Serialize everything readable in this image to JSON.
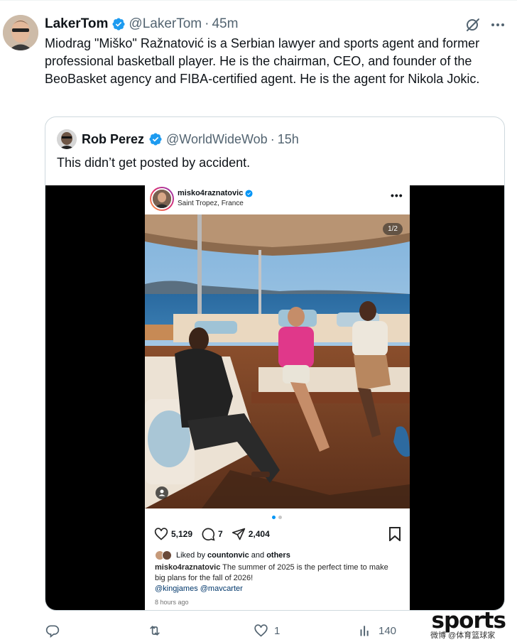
{
  "tweet": {
    "author_name": "LakerTom",
    "author_handle": "@LakerTom",
    "separator": "·",
    "time": "45m",
    "text": "Miodrag \"Miško\" Ražnatović is a Serbian lawyer and sports agent and former professional basketball player. He is the chairman, CEO, and founder of the BeoBasket agency and FIBA-certified agent. He is the agent for Nikola Jokic."
  },
  "quote": {
    "author_name": "Rob Perez",
    "author_handle": "@WorldWideWob",
    "separator": "·",
    "time": "15h",
    "text": "This didn’t get posted by accident."
  },
  "instagram": {
    "username": "misko4raznatovic",
    "location": "Saint Tropez, France",
    "more": "•••",
    "counter": "1/2",
    "likes": "5,129",
    "comments": "7",
    "shares": "2,404",
    "liked_prefix": "Liked by ",
    "liked_user": "countonvic",
    "liked_and": " and ",
    "liked_others": "others",
    "caption_user": "misko4raznatovic",
    "caption_text": " The summer of 2025 is the perfect time to make big plans for the fall of 2026!",
    "caption_mentions": "@kingjames @mavcarter",
    "time": "8 hours ago"
  },
  "actions": {
    "reply_count": "",
    "retweet_count": "",
    "like_count": "1",
    "views_count": "140"
  },
  "watermark": {
    "brand": "sports",
    "subtext": "微博 @体育篮球家"
  },
  "colors": {
    "verified": "#1d9bf0",
    "muted": "#536471",
    "border": "#cfd9de",
    "ig_link": "#00376b"
  }
}
